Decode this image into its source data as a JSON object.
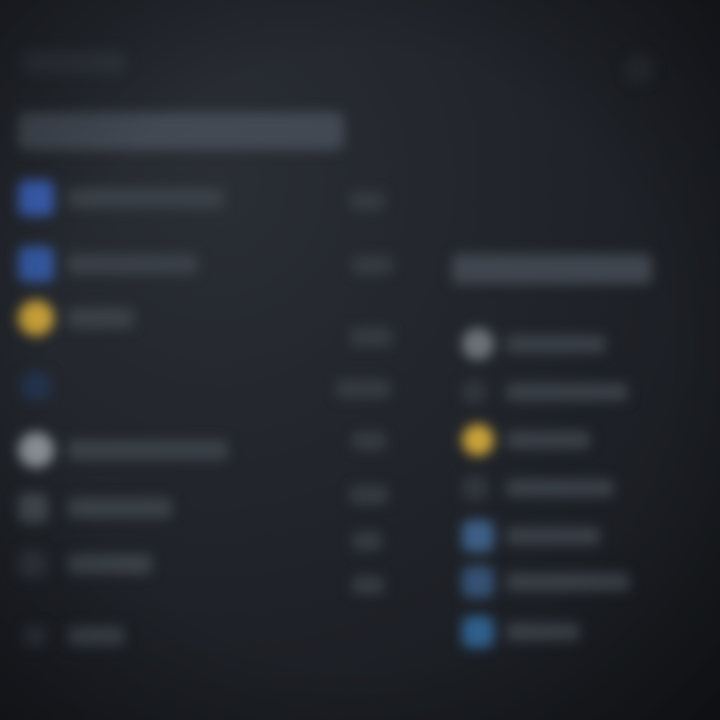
{
  "icons": {
    "left": [
      "app-icon-blue",
      "app-icon-blue",
      "app-icon-gold",
      "app-icon-navy",
      "avatar-icon",
      "app-icon-slate",
      "app-icon-dim",
      "app-icon-dim"
    ],
    "right": [
      "avatar-icon",
      "app-icon-dim",
      "app-icon-gold",
      "app-icon-dim",
      "app-icon-steel",
      "app-icon-steel",
      "app-icon-azure"
    ]
  },
  "colors": {
    "background": "#1e2127",
    "accent_blue": "#3b5fb3",
    "accent_gold": "#c9a23a",
    "steel_blue": "#3d5f87"
  }
}
